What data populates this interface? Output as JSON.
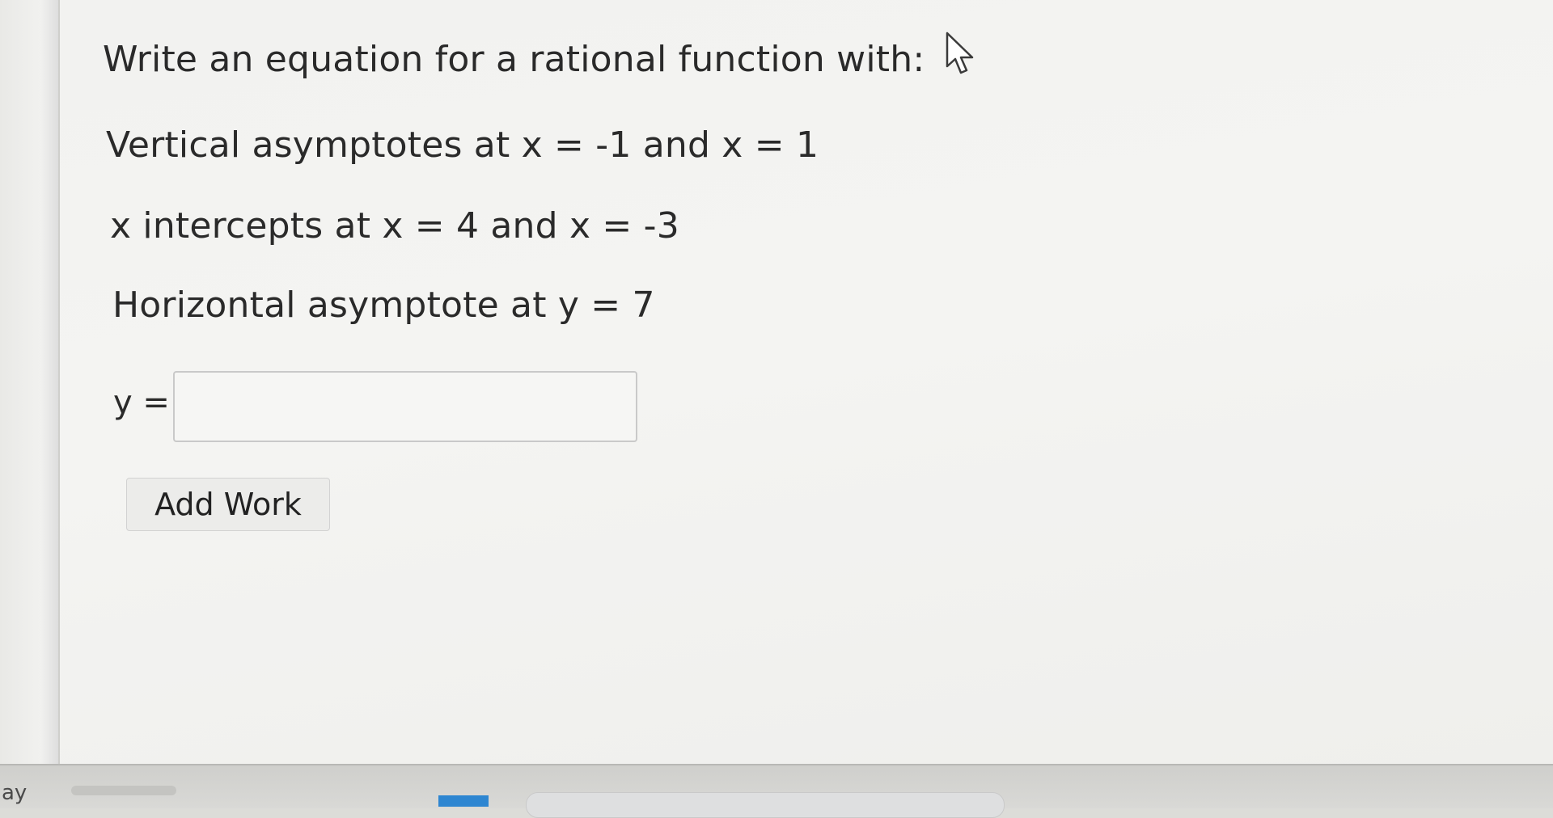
{
  "question": {
    "title": "Write an equation for a rational function with:",
    "vertical": "Vertical asymptotes at x = -1 and x = 1",
    "x_intercepts": "x intercepts at x = 4 and x = -3",
    "horizontal": "Horizontal asymptote at y = 7"
  },
  "answer": {
    "label": "y =",
    "value": ""
  },
  "buttons": {
    "add_work": "Add Work"
  },
  "bottom": {
    "left_text": "ay"
  },
  "icons": {
    "cursor": "mouse-pointer-icon"
  },
  "colors": {
    "text": "#2a2a2a",
    "taskbar_accent": "#2e86d1"
  }
}
